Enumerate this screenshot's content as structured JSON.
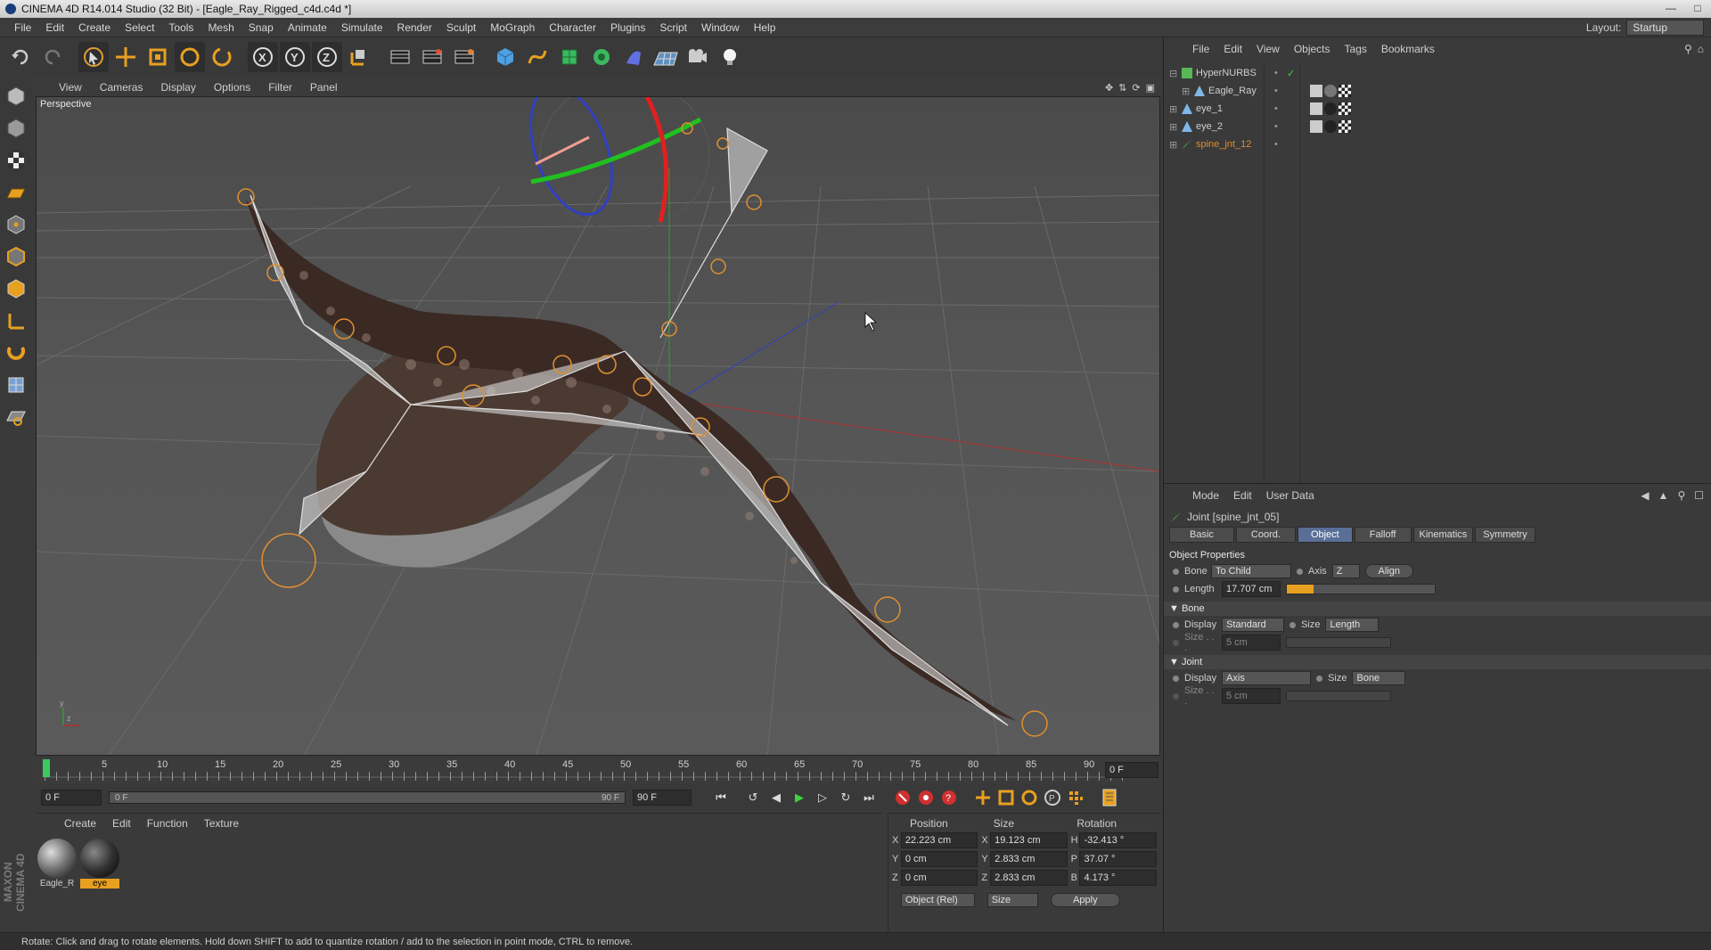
{
  "window": {
    "title": "CINEMA 4D R14.014 Studio (32 Bit) - [Eagle_Ray_Rigged_c4d.c4d *]"
  },
  "menubar": {
    "items": [
      "File",
      "Edit",
      "Create",
      "Select",
      "Tools",
      "Mesh",
      "Snap",
      "Animate",
      "Simulate",
      "Render",
      "Sculpt",
      "MoGraph",
      "Character",
      "Plugins",
      "Script",
      "Window",
      "Help"
    ],
    "layout_label": "Layout:",
    "layout_value": "Startup"
  },
  "viewport": {
    "menu": [
      "View",
      "Cameras",
      "Display",
      "Options",
      "Filter",
      "Panel"
    ],
    "label": "Perspective"
  },
  "timeline": {
    "ticks": [
      "0",
      "5",
      "10",
      "15",
      "20",
      "25",
      "30",
      "35",
      "40",
      "45",
      "50",
      "55",
      "60",
      "65",
      "70",
      "75",
      "80",
      "85",
      "90"
    ],
    "current_frame": "0 F",
    "start_frame": "0 F",
    "range_start": "0 F",
    "range_end": "90 F",
    "end_frame": "90 F"
  },
  "material_manager": {
    "menu": [
      "Create",
      "Edit",
      "Function",
      "Texture"
    ],
    "materials": [
      {
        "label": "Eagle_R",
        "selected": false
      },
      {
        "label": "eye",
        "selected": true
      }
    ]
  },
  "coordinates": {
    "headers": [
      "Position",
      "Size",
      "Rotation"
    ],
    "rows": [
      {
        "pos_axis": "X",
        "pos": "22.223 cm",
        "size_axis": "X",
        "size": "19.123 cm",
        "rot_axis": "H",
        "rot": "-32.413 °"
      },
      {
        "pos_axis": "Y",
        "pos": "0 cm",
        "size_axis": "Y",
        "size": "2.833 cm",
        "rot_axis": "P",
        "rot": "37.07 °"
      },
      {
        "pos_axis": "Z",
        "pos": "0 cm",
        "size_axis": "Z",
        "size": "2.833 cm",
        "rot_axis": "B",
        "rot": "4.173 °"
      }
    ],
    "mode": "Object (Rel)",
    "size_mode": "Size",
    "apply": "Apply"
  },
  "object_manager": {
    "menu": [
      "File",
      "Edit",
      "View",
      "Objects",
      "Tags",
      "Bookmarks"
    ],
    "objects": [
      {
        "name": "HyperNURBS",
        "indent": 0,
        "color": "#cfcfcf",
        "icon_color": "#58b858"
      },
      {
        "name": "Eagle_Ray",
        "indent": 1,
        "color": "#cfcfcf",
        "icon_color": "#7fb8e8"
      },
      {
        "name": "eye_1",
        "indent": 0,
        "color": "#cfcfcf",
        "icon_color": "#7fb8e8"
      },
      {
        "name": "eye_2",
        "indent": 0,
        "color": "#cfcfcf",
        "icon_color": "#7fb8e8"
      },
      {
        "name": "spine_jnt_12",
        "indent": 0,
        "color": "#e08a2a",
        "icon_color": "#58b858"
      }
    ]
  },
  "attribute_manager": {
    "menu": [
      "Mode",
      "Edit",
      "User Data"
    ],
    "title": "Joint [spine_jnt_05]",
    "tabs": [
      {
        "label": "Basic",
        "active": false
      },
      {
        "label": "Coord.",
        "active": false
      },
      {
        "label": "Object",
        "active": true
      },
      {
        "label": "Falloff",
        "active": false
      },
      {
        "label": "Kinematics",
        "active": false
      },
      {
        "label": "Symmetry",
        "active": false
      }
    ],
    "section_title": "Object Properties",
    "bone_label": "Bone",
    "bone_value": "To Child",
    "axis_label": "Axis",
    "axis_value": "Z",
    "align_label": "Align",
    "length_label": "Length",
    "length_value": "17.707 cm",
    "bone_section": "Bone",
    "bone_display_label": "Display",
    "bone_display_value": "Standard",
    "bone_size_label": "Size",
    "bone_size_value": "Length",
    "bone_size2_label": "Size . . .",
    "bone_size2_value": "5 cm",
    "joint_section": "Joint",
    "joint_display_label": "Display",
    "joint_display_value": "Axis",
    "joint_size_label": "Size",
    "joint_size_value": "Bone",
    "joint_size2_label": "Size . . .",
    "joint_size2_value": "5 cm"
  },
  "statusbar": {
    "text": "Rotate: Click and drag to rotate elements. Hold down SHIFT to add to quantize rotation / add to the selection in point mode, CTRL to remove."
  },
  "brand": "MAXON CINEMA 4D"
}
